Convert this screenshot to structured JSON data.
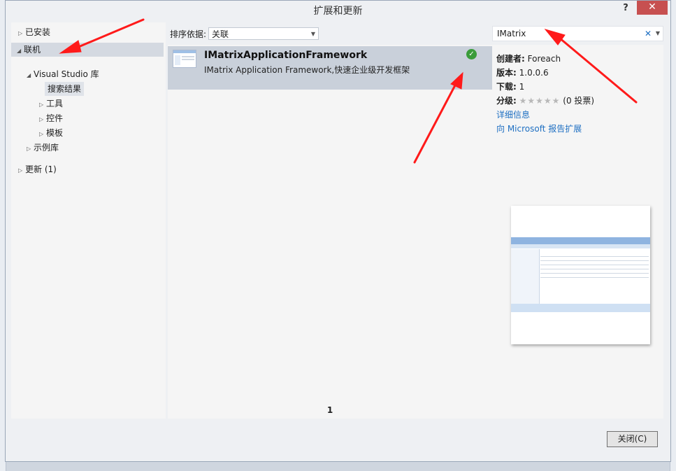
{
  "window": {
    "title": "扩展和更新",
    "help_label": "?",
    "close_label": "✕"
  },
  "tree": {
    "installed": "已安装",
    "online": "联机",
    "vs_gallery": "Visual Studio 库",
    "search_results": "搜索结果",
    "tools": "工具",
    "controls": "控件",
    "templates": "模板",
    "samples": "示例库",
    "updates": "更新 (1)"
  },
  "sort": {
    "label": "排序依据:",
    "value": "关联"
  },
  "search": {
    "value": "IMatrix",
    "clear_label": "✕"
  },
  "result": {
    "title": "IMatrixApplicationFramework",
    "description": "IMatrix Application Framework,快速企业级开发框架",
    "check": "✓"
  },
  "pager": {
    "page": "1"
  },
  "details": {
    "creator_label": "创建者:",
    "creator_value": "Foreach",
    "version_label": "版本:",
    "version_value": "1.0.0.6",
    "downloads_label": "下载:",
    "downloads_value": "1",
    "rating_label": "分级:",
    "rating_stars": "★★★★★",
    "rating_votes": "(0 投票)",
    "more_info": "详细信息",
    "report": "向 Microsoft 报告扩展"
  },
  "footer": {
    "close_button": "关闭(C)"
  },
  "colors": {
    "accent": "#1e6fc2",
    "selected_bg": "#c9d0da",
    "annotation_arrow": "#ff1a1a"
  }
}
